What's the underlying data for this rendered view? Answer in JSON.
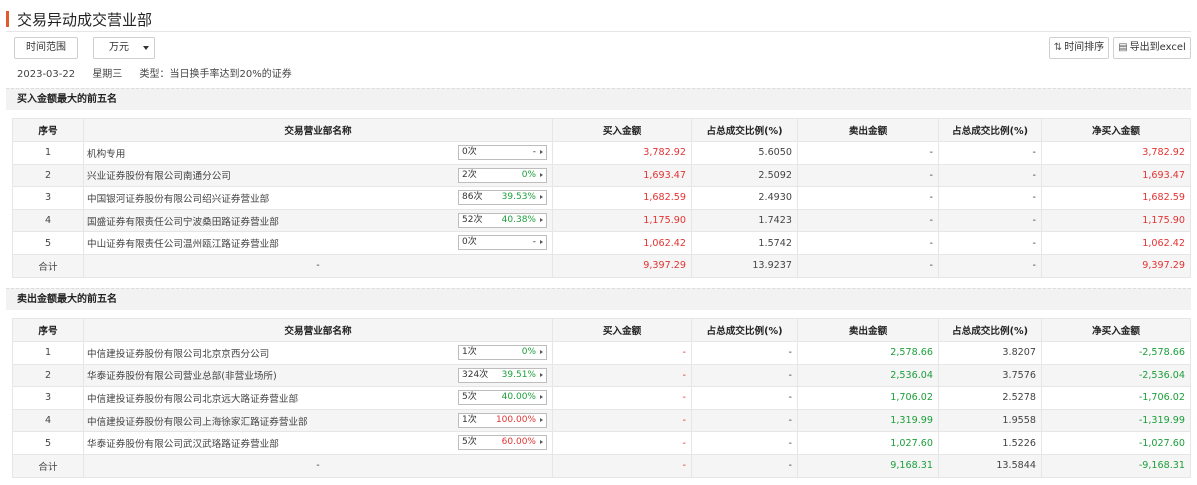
{
  "page": {
    "title": "交易异动成交营业部"
  },
  "toolbar": {
    "range_label": "时间范围",
    "unit_selected": "万元",
    "sort_label": "时间排序",
    "export_label": "导出到excel"
  },
  "meta": {
    "date": "2023-03-22",
    "weekday": "星期三",
    "type": "类型：当日换手率达到20%的证券"
  },
  "buy_section": {
    "title": "买入金额最大的前五名",
    "headers": [
      "序号",
      "交易营业部名称",
      "买入金额",
      "占总成交比例(%)",
      "卖出金额",
      "占总成交比例(%)",
      "净买入金额"
    ],
    "rows": [
      {
        "no": "1",
        "name": "机构专用",
        "count": "0次",
        "pct": "-",
        "pct_color": "neutral",
        "buy": "3,782.92",
        "buy_ratio": "5.6050",
        "sell": "-",
        "sell_ratio": "-",
        "net": "3,782.92"
      },
      {
        "no": "2",
        "name": "兴业证券股份有限公司南通分公司",
        "count": "2次",
        "pct": "0%",
        "pct_color": "green",
        "buy": "1,693.47",
        "buy_ratio": "2.5092",
        "sell": "-",
        "sell_ratio": "-",
        "net": "1,693.47"
      },
      {
        "no": "3",
        "name": "中国银河证券股份有限公司绍兴证券营业部",
        "count": "86次",
        "pct": "39.53%",
        "pct_color": "green",
        "buy": "1,682.59",
        "buy_ratio": "2.4930",
        "sell": "-",
        "sell_ratio": "-",
        "net": "1,682.59"
      },
      {
        "no": "4",
        "name": "国盛证券有限责任公司宁波桑田路证券营业部",
        "count": "52次",
        "pct": "40.38%",
        "pct_color": "green",
        "buy": "1,175.90",
        "buy_ratio": "1.7423",
        "sell": "-",
        "sell_ratio": "-",
        "net": "1,175.90"
      },
      {
        "no": "5",
        "name": "中山证券有限责任公司温州瓯江路证券营业部",
        "count": "0次",
        "pct": "-",
        "pct_color": "neutral",
        "buy": "1,062.42",
        "buy_ratio": "1.5742",
        "sell": "-",
        "sell_ratio": "-",
        "net": "1,062.42"
      }
    ],
    "total": {
      "label": "合计",
      "name": "-",
      "buy": "9,397.29",
      "buy_ratio": "13.9237",
      "sell": "-",
      "sell_ratio": "-",
      "net": "9,397.29"
    }
  },
  "sell_section": {
    "title": "卖出金额最大的前五名",
    "headers": [
      "序号",
      "交易营业部名称",
      "买入金额",
      "占总成交比例(%)",
      "卖出金额",
      "占总成交比例(%)",
      "净买入金额"
    ],
    "rows": [
      {
        "no": "1",
        "name": "中信建投证券股份有限公司北京京西分公司",
        "count": "1次",
        "pct": "0%",
        "pct_color": "green",
        "buy": "-",
        "buy_ratio": "-",
        "sell": "2,578.66",
        "sell_ratio": "3.8207",
        "net": "-2,578.66"
      },
      {
        "no": "2",
        "name": "华泰证券股份有限公司营业总部(非营业场所)",
        "count": "324次",
        "pct": "39.51%",
        "pct_color": "green",
        "buy": "-",
        "buy_ratio": "-",
        "sell": "2,536.04",
        "sell_ratio": "3.7576",
        "net": "-2,536.04"
      },
      {
        "no": "3",
        "name": "中信建投证券股份有限公司北京远大路证券营业部",
        "count": "5次",
        "pct": "40.00%",
        "pct_color": "green",
        "buy": "-",
        "buy_ratio": "-",
        "sell": "1,706.02",
        "sell_ratio": "2.5278",
        "net": "-1,706.02"
      },
      {
        "no": "4",
        "name": "中信建投证券股份有限公司上海徐家汇路证券营业部",
        "count": "1次",
        "pct": "100.00%",
        "pct_color": "red",
        "buy": "-",
        "buy_ratio": "-",
        "sell": "1,319.99",
        "sell_ratio": "1.9558",
        "net": "-1,319.99"
      },
      {
        "no": "5",
        "name": "华泰证券股份有限公司武汉武珞路证券营业部",
        "count": "5次",
        "pct": "60.00%",
        "pct_color": "red",
        "buy": "-",
        "buy_ratio": "-",
        "sell": "1,027.60",
        "sell_ratio": "1.5226",
        "net": "-1,027.60"
      }
    ],
    "total": {
      "label": "合计",
      "name": "-",
      "buy": "-",
      "buy_ratio": "-",
      "sell": "9,168.31",
      "sell_ratio": "13.5844",
      "net": "-9,168.31"
    }
  },
  "colors": {
    "accent": "#e05a2b",
    "up": "#e33333",
    "down": "#1b9f3a"
  }
}
